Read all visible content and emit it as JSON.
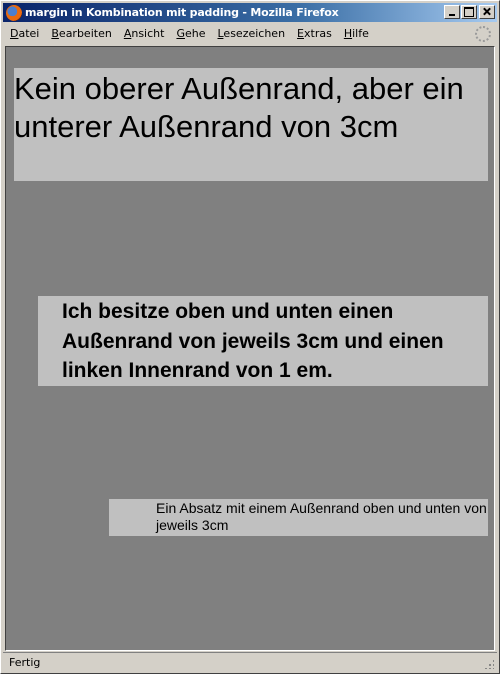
{
  "window": {
    "title": "margin in Kombination mit padding - Mozilla Firefox"
  },
  "menubar": {
    "items": [
      {
        "accel": "D",
        "rest": "atei"
      },
      {
        "accel": "B",
        "rest": "earbeiten"
      },
      {
        "accel": "A",
        "rest": "nsicht"
      },
      {
        "accel": "G",
        "rest": "ehe"
      },
      {
        "accel": "L",
        "rest": "esezeichen"
      },
      {
        "accel": "E",
        "rest": "xtras"
      },
      {
        "accel": "H",
        "rest": "ilfe"
      }
    ]
  },
  "page": {
    "background_color": "#808080",
    "box_color": "#c0c0c0",
    "paragraph1": "Kein oberer Außenrand, aber ein unterer Außenrand von 3cm",
    "paragraph2": "Ich besitze oben und unten einen Außenrand von jeweils 3cm und einen linken Innenrand von 1 em.",
    "paragraph3": "Ein Absatz mit einem Außenrand oben und unten von jeweils 3cm"
  },
  "statusbar": {
    "text": "Fertig"
  }
}
